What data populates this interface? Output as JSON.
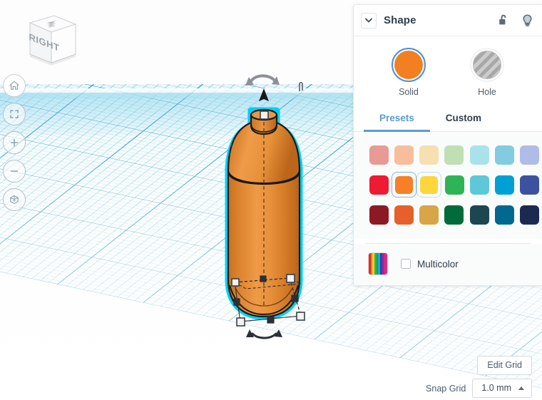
{
  "app": {
    "viewcube_label": "RIGHT",
    "viewcube_top_icon": "compass-icon"
  },
  "left_toolbar": {
    "items": [
      {
        "name": "home-view",
        "icon": "home-icon"
      },
      {
        "name": "fit-to-view",
        "icon": "fit-frame-icon"
      },
      {
        "name": "zoom-in",
        "icon": "plus-icon"
      },
      {
        "name": "zoom-out",
        "icon": "minus-icon"
      },
      {
        "name": "ortho-perspective-toggle",
        "icon": "cube-perspective-icon"
      }
    ]
  },
  "shape_panel": {
    "title": "Shape",
    "collapse_icon": "chevron-down-icon",
    "header_icons": [
      {
        "name": "lock-open-icon",
        "label": "Unlocked"
      },
      {
        "name": "lightbulb-icon",
        "label": "Visibility"
      }
    ],
    "mode": {
      "solid": {
        "label": "Solid",
        "color": "#f28021",
        "selected": true
      },
      "hole": {
        "label": "Hole",
        "color": "#b4b4b4",
        "selected": false
      }
    },
    "tabs": [
      {
        "label": "Presets",
        "active": true
      },
      {
        "label": "Custom",
        "active": false
      }
    ],
    "palette": {
      "rows": [
        [
          {
            "color": "#e89a95",
            "state": "none"
          },
          {
            "color": "#f8bd9a",
            "state": "none"
          },
          {
            "color": "#f6dfb0",
            "state": "none"
          },
          {
            "color": "#bfdfb4",
            "state": "none"
          },
          {
            "color": "#a9e3e9",
            "state": "none"
          },
          {
            "color": "#83cbe0",
            "state": "none"
          },
          {
            "color": "#afbce8",
            "state": "none"
          }
        ],
        [
          {
            "color": "#ed1b34",
            "state": "none"
          },
          {
            "color": "#f68027",
            "state": "selected"
          },
          {
            "color": "#fcd63c",
            "state": "hover"
          },
          {
            "color": "#2eb457",
            "state": "none"
          },
          {
            "color": "#5ec8d8",
            "state": "none"
          },
          {
            "color": "#00a0d6",
            "state": "none"
          },
          {
            "color": "#3d529e",
            "state": "none"
          }
        ],
        [
          {
            "color": "#8c1a24",
            "state": "none"
          },
          {
            "color": "#e5602a",
            "state": "none"
          },
          {
            "color": "#d8a648",
            "state": "none"
          },
          {
            "color": "#026b3c",
            "state": "none"
          },
          {
            "color": "#1d4750",
            "state": "none"
          },
          {
            "color": "#02688f",
            "state": "none"
          },
          {
            "color": "#1c2a52",
            "state": "none"
          }
        ]
      ],
      "multicolor": {
        "label": "Multicolor",
        "checked": false,
        "swatch_icon": "rainbow-swatch"
      }
    }
  },
  "workplane_controls": {
    "edit_grid_label": "Edit Grid",
    "snap_grid_label": "Snap Grid",
    "snap_grid_value": "1.0 mm",
    "snap_caret_icon": "caret-up-icon"
  },
  "scene": {
    "object_name": "bottle",
    "object_color": "#e0862e",
    "selection_outline_color": "#00d0f5",
    "gizmos": {
      "rotate_top_icon": "rotate-arrow-icon",
      "rotate_bottom_icon": "rotate-arrow-icon",
      "height_arrow_icon": "up-arrow-handle",
      "ruler_icon": "ruler-handle-icon"
    }
  }
}
